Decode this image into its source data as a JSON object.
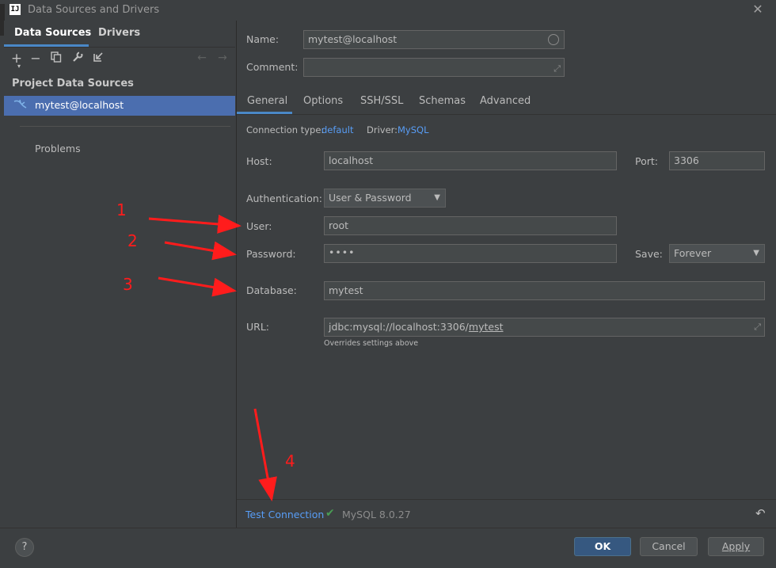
{
  "window": {
    "title": "Data Sources and Drivers",
    "app_icon_text": "IJ"
  },
  "left": {
    "tabs": [
      "Data Sources",
      "Drivers"
    ],
    "section_header": "Project Data Sources",
    "selected_item": "mytest@localhost",
    "problems_label": "Problems"
  },
  "form": {
    "name_label": "Name:",
    "name_value": "mytest@localhost",
    "comment_label": "Comment:",
    "comment_value": "",
    "tabs": [
      "General",
      "Options",
      "SSH/SSL",
      "Schemas",
      "Advanced"
    ],
    "conn_type_label": "Connection type:",
    "conn_type_value": "default",
    "driver_label": "Driver:",
    "driver_value": "MySQL",
    "host_label": "Host:",
    "host_value": "localhost",
    "port_label": "Port:",
    "port_value": "3306",
    "auth_label": "Authentication:",
    "auth_value": "User & Password",
    "user_label": "User:",
    "user_value": "root",
    "password_label": "Password:",
    "password_value": "••••",
    "save_label": "Save:",
    "save_value": "Forever",
    "database_label": "Database:",
    "database_value": "mytest",
    "url_label": "URL:",
    "url_prefix": "jdbc:mysql://localhost:3306/",
    "url_db": "mytest",
    "url_hint": "Overrides settings above"
  },
  "status": {
    "test_connection": "Test Connection",
    "version": "MySQL 8.0.27"
  },
  "buttons": {
    "help": "?",
    "ok": "OK",
    "cancel": "Cancel",
    "apply": "Apply"
  },
  "annotations": [
    "1",
    "2",
    "3",
    "4"
  ],
  "colors": {
    "accent": "#4a88c7",
    "link": "#589df6",
    "selection": "#4b6eaf",
    "annotation": "#ff1c1c",
    "success": "#499c54"
  }
}
